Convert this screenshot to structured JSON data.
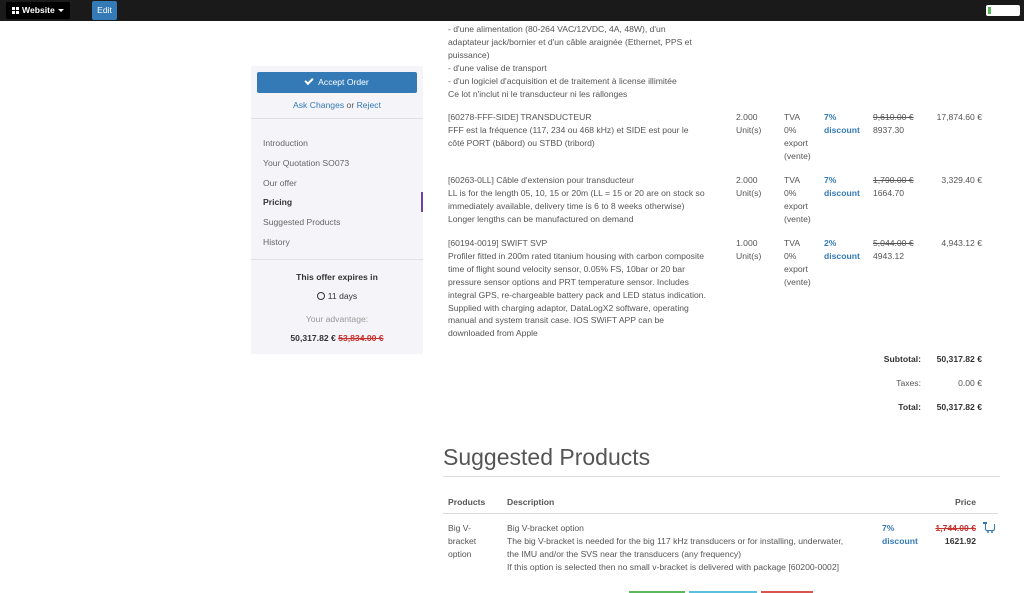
{
  "topbar": {
    "website_label": "Website",
    "edit_label": "Edit"
  },
  "sidebar": {
    "accept_label": "Accept Order",
    "ask_changes": "Ask Changes",
    "or": "or",
    "reject": "Reject",
    "nav": [
      "Introduction",
      "Your Quotation SO073",
      "Our offer",
      "Pricing",
      "Suggested Products",
      "History"
    ],
    "active_nav": "Pricing",
    "expires_label": "This offer expires in",
    "expires_value": "11 days",
    "advantage_label": "Your advantage:",
    "advantage_value": "50,317.82 €",
    "advantage_old": "53,834.00 €"
  },
  "order_lines": [
    {
      "description": [
        "- d'une alimentation (80-264 VAC/12VDC, 4A, 48W), d'un",
        "adaptateur jack/bornier et d'un câble araignée (Ethernet, PPS et",
        "puissance)",
        "- d'une valise de transport",
        "- d'un logiciel d'acquisition et de traitement à license illimitée",
        "Ce lot n'inclut ni le transducteur ni les rallonges"
      ]
    },
    {
      "description": [
        "[60278-FFF-SIDE] TRANSDUCTEUR",
        "FFF est la fréquence (117, 234 ou 468 kHz) et SIDE est pour le",
        "côté PORT (bâbord) ou STBD (tribord)"
      ],
      "qty": [
        "2.000",
        "Unit(s)"
      ],
      "tax": [
        "TVA",
        "0%",
        "export",
        "(vente)"
      ],
      "discount": [
        "7%",
        "discount"
      ],
      "old_price": "9,610.00 €",
      "new_price": "8937.30",
      "total": "17,874.60 €"
    },
    {
      "description": [
        "[60263-0LL] Câble d'extension pour transducteur",
        "LL is for the length 05, 10, 15 or 20m (LL = 15 or 20 are on stock so",
        "immediately available, delivery time is 6 to 8 weeks otherwise)",
        "Longer lengths can be manufactured on demand"
      ],
      "qty": [
        "2.000",
        "Unit(s)"
      ],
      "tax": [
        "TVA",
        "0%",
        "export",
        "(vente)"
      ],
      "discount": [
        "7%",
        "discount"
      ],
      "old_price": "1,790.00 €",
      "new_price": "1664.70",
      "total": "3,329.40 €"
    },
    {
      "description": [
        "[60194-0019] SWIFT SVP",
        "Profiler fitted in 200m rated titanium housing with carbon composite",
        "time of flight sound velocity sensor, 0.05% FS, 10bar or 20 bar",
        "pressure sensor options and PRT temperature sensor. Includes",
        "integral GPS, re-chargeable battery pack and LED status indication.",
        "Supplied with charging adaptor, DataLogX2 software, operating",
        "manual and system transit case. IOS SWiFT APP can be",
        "downloaded from Apple"
      ],
      "qty": [
        "1.000",
        "Unit(s)"
      ],
      "tax": [
        "TVA",
        "0%",
        "export",
        "(vente)"
      ],
      "discount": [
        "2%",
        "discount"
      ],
      "old_price": "5,044.00 €",
      "new_price": "4943.12",
      "total": "4,943.12 €"
    }
  ],
  "summary": {
    "subtotal_label": "Subtotal:",
    "subtotal": "50,317.82 €",
    "taxes_label": "Taxes:",
    "taxes": "0.00 €",
    "total_label": "Total:",
    "total": "50,317.82 €"
  },
  "suggested": {
    "title": "Suggested Products",
    "col_products": "Products",
    "col_description": "Description",
    "col_price": "Price",
    "item": {
      "name": [
        "Big V-",
        "bracket",
        "option"
      ],
      "description": [
        "Big V-bracket option",
        "The big V-bracket is needed for the big 117 kHz transducers or for installing, underwater,",
        "the IMU and/or the SVS near the transducers (any frequency)",
        "If this option is selected then no small v-bracket is delivered with package [60200-0002]"
      ],
      "discount": [
        "7%",
        "discount"
      ],
      "old_price": "1,744.00 €",
      "new_price": "1621.92"
    }
  },
  "colors": {
    "accent": "#337ab7",
    "strike": "#c9302c",
    "sidebar_bg": "#f5f4f8"
  }
}
